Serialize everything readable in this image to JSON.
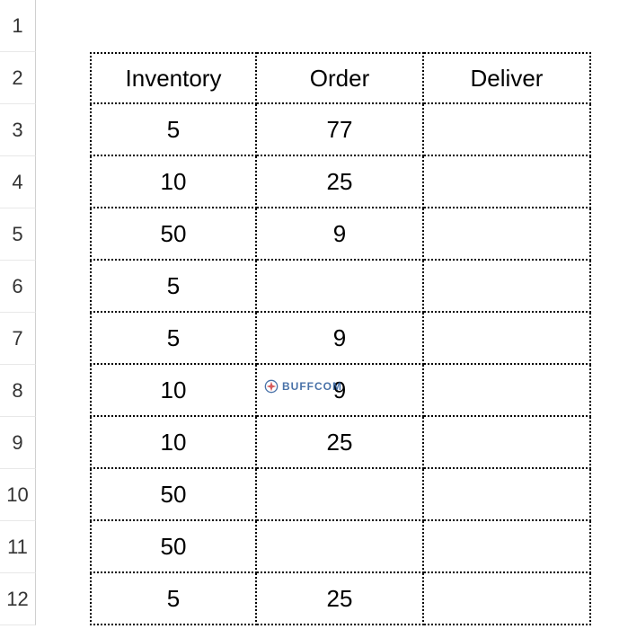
{
  "row_headers": [
    "1",
    "2",
    "3",
    "4",
    "5",
    "6",
    "7",
    "8",
    "9",
    "10",
    "11",
    "12"
  ],
  "headers": {
    "b": "Inventory",
    "c": "Order",
    "d": "Deliver"
  },
  "rows": [
    {
      "b": "5",
      "c": "77",
      "d": ""
    },
    {
      "b": "10",
      "c": "25",
      "d": ""
    },
    {
      "b": "50",
      "c": "9",
      "d": ""
    },
    {
      "b": "5",
      "c": "",
      "d": ""
    },
    {
      "b": "5",
      "c": "9",
      "d": ""
    },
    {
      "b": "10",
      "c": "9",
      "d": ""
    },
    {
      "b": "10",
      "c": "25",
      "d": ""
    },
    {
      "b": "50",
      "c": "",
      "d": ""
    },
    {
      "b": "50",
      "c": "",
      "d": ""
    },
    {
      "b": "5",
      "c": "25",
      "d": ""
    }
  ],
  "watermark": "BUFFCOM"
}
